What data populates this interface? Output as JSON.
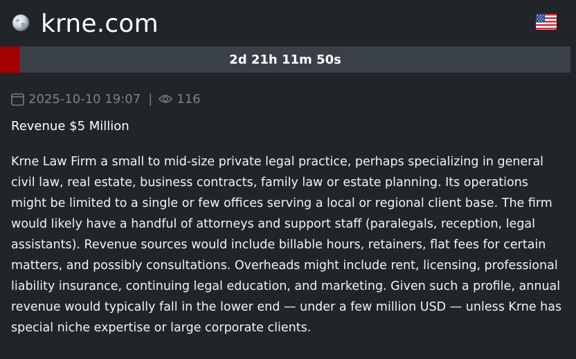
{
  "header": {
    "site_name": "krne.com",
    "globe_icon": "globe-icon",
    "flag_icon": "us-flag-icon"
  },
  "timer": {
    "remaining": "2d 21h 11m 50s",
    "progress_percent": 3.4,
    "fill_color": "#a30000",
    "track_color": "#3a4047"
  },
  "meta": {
    "date": "2025-10-10 19:07",
    "separator": "|",
    "views": "116",
    "date_icon": "calendar-icon",
    "views_icon": "eye-icon"
  },
  "revenue": "Revenue $5 Million",
  "description": "Krne Law Firm a small to mid-size private legal practice, perhaps specializing in general civil law, real estate, business contracts, family law or estate planning. Its operations might be limited to a single or few offices serving a local or regional client base. The firm would likely have a handful of attorneys and support staff (paralegals, reception, legal assistants). Revenue sources would include billable hours, retainers, flat fees for certain matters, and possibly consultations. Overheads might include rent, licensing, professional liability insurance, continuing legal education, and marketing. Given such a profile, annual revenue would typically fall in the lower end — under a few million USD — unless Krne has special niche expertise or large corporate clients."
}
